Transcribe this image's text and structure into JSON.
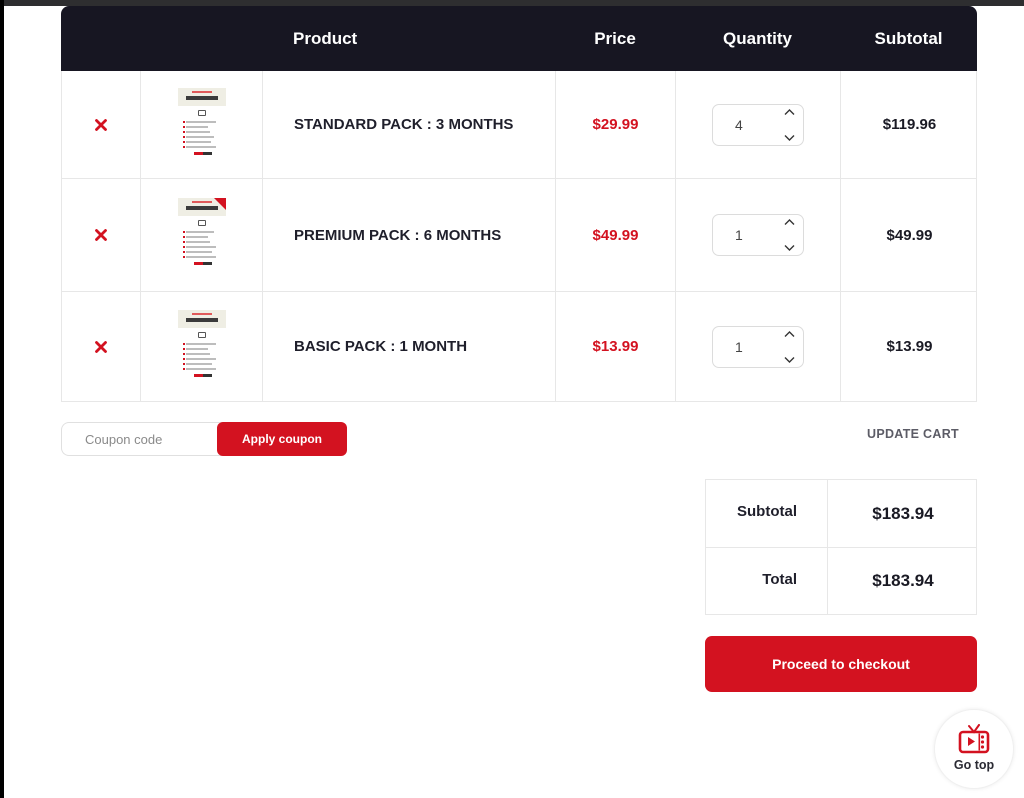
{
  "colors": {
    "accent": "#d31220",
    "header_bg": "#171622",
    "text_dark": "#1a1a24",
    "border": "#e7e7e7"
  },
  "cart": {
    "headers": {
      "remove": "",
      "thumbnail": "",
      "product": "Product",
      "price": "Price",
      "quantity": "Quantity",
      "subtotal": "Subtotal"
    },
    "items": [
      {
        "name": "STANDARD PACK : 3 MONTHS",
        "price": "$29.99",
        "quantity": "4",
        "subtotal": "$119.96",
        "thumbnail_icon": "standard-pack-thumbnail",
        "remove_icon": "close-icon"
      },
      {
        "name": "PREMIUM PACK : 6 MONTHS",
        "price": "$49.99",
        "quantity": "1",
        "subtotal": "$49.99",
        "thumbnail_icon": "premium-pack-thumbnail",
        "remove_icon": "close-icon"
      },
      {
        "name": "BASIC PACK : 1 MONTH",
        "price": "$13.99",
        "quantity": "1",
        "subtotal": "$13.99",
        "thumbnail_icon": "basic-pack-thumbnail",
        "remove_icon": "close-icon"
      }
    ]
  },
  "coupon": {
    "placeholder": "Coupon code",
    "value": "",
    "apply_label": "Apply coupon"
  },
  "update_cart_label": "UPDATE CART",
  "totals": {
    "subtotal_label": "Subtotal",
    "subtotal_value": "$183.94",
    "total_label": "Total",
    "total_value": "$183.94"
  },
  "checkout_label": "Proceed to checkout",
  "go_top": {
    "label": "Go top",
    "icon": "tv-icon"
  }
}
